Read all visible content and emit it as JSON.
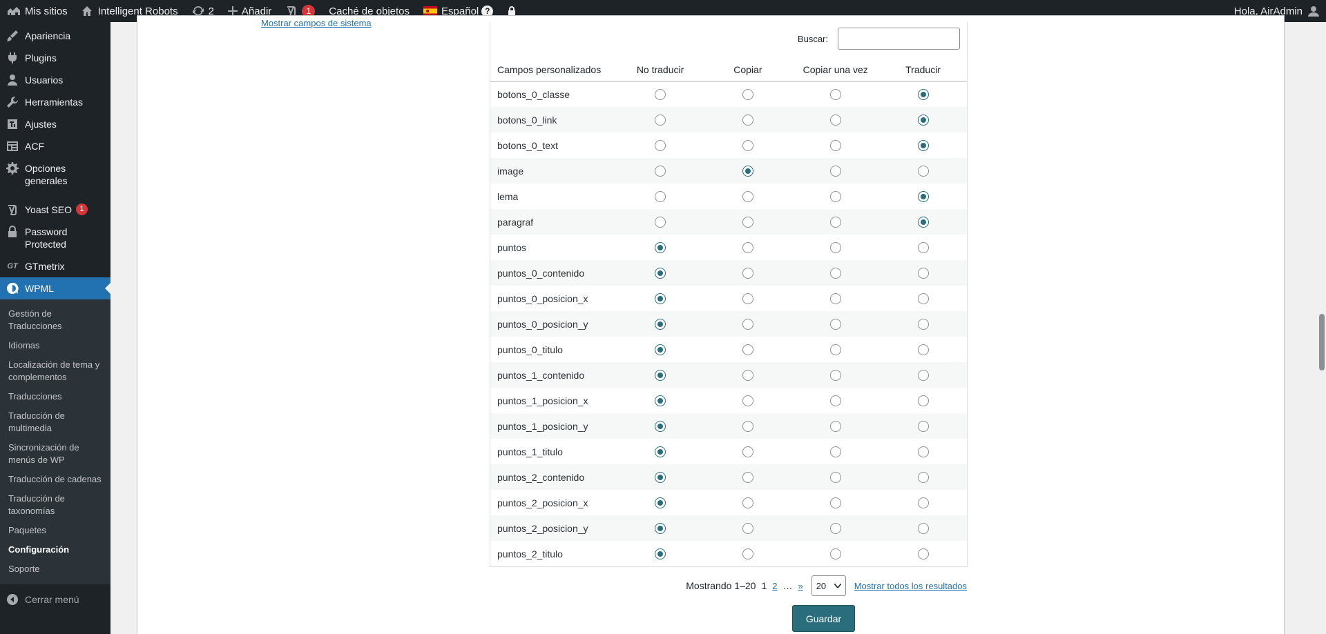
{
  "adminbar": {
    "my_sites": "Mis sitios",
    "site_name": "Intelligent Robots",
    "updates_count": "2",
    "add_new": "Añadir",
    "yoast_count": "1",
    "cache": "Caché de objetos",
    "language": "Español",
    "help": "?",
    "greeting": "Hola, AirAdmin"
  },
  "sidebar": {
    "items": [
      {
        "label": "Apariencia",
        "icon": "brush-icon"
      },
      {
        "label": "Plugins",
        "icon": "plug-icon"
      },
      {
        "label": "Usuarios",
        "icon": "users-icon"
      },
      {
        "label": "Herramientas",
        "icon": "wrench-icon"
      },
      {
        "label": "Ajustes",
        "icon": "settings-icon"
      },
      {
        "label": "ACF",
        "icon": "acf-icon"
      },
      {
        "label": "Opciones generales",
        "icon": "gear-icon"
      }
    ],
    "yoast_label": "Yoast SEO",
    "yoast_count": "1",
    "password_label": "Password Protected",
    "gtmetrix_label": "GTmetrix",
    "wpml_label": "WPML",
    "submenu": [
      "Gestión de Traducciones",
      "Idiomas",
      "Localización de tema y complementos",
      "Traducciones",
      "Traducción de multimedia",
      "Sincronización de menús de WP",
      "Traducción de cadenas",
      "Traducción de taxonomías",
      "Paquetes",
      "Configuración",
      "Soporte"
    ],
    "submenu_current": "Configuración",
    "collapse": "Cerrar menú"
  },
  "main": {
    "system_fields_link": "Mostrar campos de sistema",
    "search_label": "Buscar:",
    "search_value": "",
    "columns": [
      "Campos personalizados",
      "No traducir",
      "Copiar",
      "Copiar una vez",
      "Traducir"
    ],
    "rows": [
      {
        "name": "botons_0_classe",
        "selected": 3
      },
      {
        "name": "botons_0_link",
        "selected": 3
      },
      {
        "name": "botons_0_text",
        "selected": 3
      },
      {
        "name": "image",
        "selected": 1
      },
      {
        "name": "lema",
        "selected": 3
      },
      {
        "name": "paragraf",
        "selected": 3
      },
      {
        "name": "puntos",
        "selected": 0
      },
      {
        "name": "puntos_0_contenido",
        "selected": 0
      },
      {
        "name": "puntos_0_posicion_x",
        "selected": 0
      },
      {
        "name": "puntos_0_posicion_y",
        "selected": 0
      },
      {
        "name": "puntos_0_titulo",
        "selected": 0
      },
      {
        "name": "puntos_1_contenido",
        "selected": 0
      },
      {
        "name": "puntos_1_posicion_x",
        "selected": 0
      },
      {
        "name": "puntos_1_posicion_y",
        "selected": 0
      },
      {
        "name": "puntos_1_titulo",
        "selected": 0
      },
      {
        "name": "puntos_2_contenido",
        "selected": 0
      },
      {
        "name": "puntos_2_posicion_x",
        "selected": 0
      },
      {
        "name": "puntos_2_posicion_y",
        "selected": 0
      },
      {
        "name": "puntos_2_titulo",
        "selected": 0
      }
    ],
    "pagination": {
      "showing": "Mostrando 1–20",
      "page_current": "1",
      "page_2": "2",
      "ellipsis": "…",
      "next": "»",
      "per_page": "20",
      "show_all": "Mostrar todos los resultados"
    },
    "save_label": "Guardar"
  },
  "colors": {
    "accent": "#2271b1",
    "wpml_button": "#2a6d7c",
    "adminbar_bg": "#1d2327"
  }
}
